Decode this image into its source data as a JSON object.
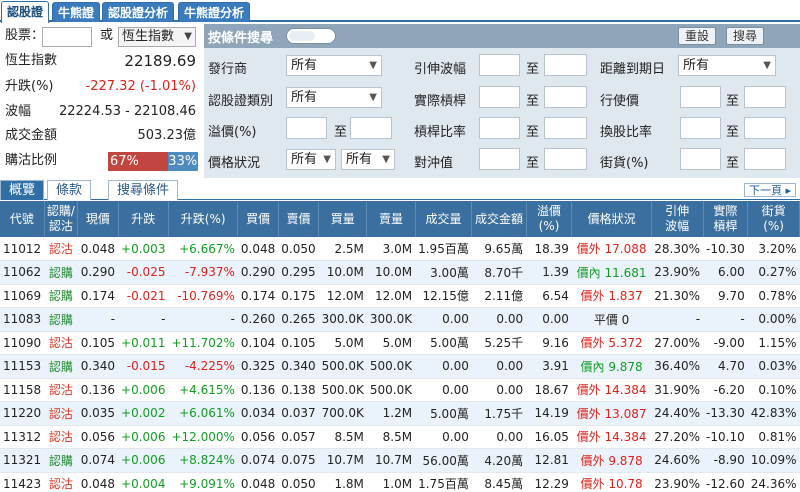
{
  "tabs": [
    "認股證",
    "牛熊證",
    "認股證分析",
    "牛熊證分析"
  ],
  "left": {
    "stock_label": "股票：",
    "or_label": "或",
    "index_select": "恆生指數",
    "index_label": "恆生指數",
    "index_value": "22189.69",
    "change_label": "升跌(%)",
    "change_value": "-227.32 (-1.01%)",
    "range_label": "波幅",
    "range_value": "22224.53 - 22108.46",
    "turnover_label": "成交金額",
    "turnover_value": "503.23億",
    "ratio_label": "購沽比例",
    "ratio_call": "67%",
    "ratio_put": "33%",
    "ratio_call_fraction": 0.67
  },
  "search": {
    "title": "按條件搜尋",
    "reset": "重設",
    "search": "搜尋",
    "to": "至",
    "issuer_label": "發行商",
    "issuer_value": "所有",
    "type_label": "認股證類別",
    "type_value": "所有",
    "premium_label": "溢價(%)",
    "price_status_label": "價格狀況",
    "price_status_value1": "所有",
    "price_status_value2": "所有",
    "iv_label": "引伸波幅",
    "eff_gear_label": "實際槓桿",
    "gear_label": "槓桿比率",
    "hedge_label": "對沖值",
    "expiry_label": "距離到期日",
    "expiry_value": "所有",
    "strike_label": "行使價",
    "conv_label": "換股比率",
    "outstanding_label": "街貨(%)"
  },
  "subtabs": [
    "概覽",
    "條款",
    "搜尋條件"
  ],
  "next_page": "下一頁",
  "table": {
    "headers": [
      "代號",
      "認購/\n認沽",
      "現價",
      "升跌",
      "升跌(%)",
      "買價",
      "賣價",
      "買量",
      "賣量",
      "成交量",
      "成交金額",
      "溢價(%)",
      "價格狀況",
      "引伸\n波幅",
      "實際\n槓桿",
      "街貨\n(%)"
    ],
    "rows": [
      {
        "code": "11012",
        "type": "認沽",
        "kind": "put",
        "price": "0.048",
        "chg": "+0.003",
        "pct": "+6.667%",
        "dir": "up",
        "bid": "0.048",
        "ask": "0.050",
        "bidq": "2.5M",
        "askq": "3.0M",
        "vol": "1.95百萬",
        "amt": "9.65萬",
        "prem": "18.39",
        "status": "價外 17.088",
        "skind": "out",
        "iv": "28.30%",
        "eg": "-10.30",
        "os": "3.20%"
      },
      {
        "code": "11062",
        "type": "認購",
        "kind": "call",
        "price": "0.290",
        "chg": "-0.025",
        "pct": "-7.937%",
        "dir": "dn",
        "bid": "0.290",
        "ask": "0.295",
        "bidq": "10.0M",
        "askq": "10.0M",
        "vol": "3.00萬",
        "amt": "8.70千",
        "prem": "1.39",
        "status": "價內 11.681",
        "skind": "in",
        "iv": "23.90%",
        "eg": "6.00",
        "os": "0.27%"
      },
      {
        "code": "11069",
        "type": "認購",
        "kind": "call",
        "price": "0.174",
        "chg": "-0.021",
        "pct": "-10.769%",
        "dir": "dn",
        "bid": "0.174",
        "ask": "0.175",
        "bidq": "12.0M",
        "askq": "12.0M",
        "vol": "12.15億",
        "amt": "2.11億",
        "prem": "6.54",
        "status": "價外 1.837",
        "skind": "out",
        "iv": "21.30%",
        "eg": "9.70",
        "os": "0.78%"
      },
      {
        "code": "11083",
        "type": "認購",
        "kind": "call",
        "price": "-",
        "chg": "-",
        "pct": "-",
        "dir": "",
        "bid": "0.260",
        "ask": "0.265",
        "bidq": "300.0K",
        "askq": "300.0K",
        "vol": "0.00",
        "amt": "0.00",
        "prem": "0.00",
        "status": "平價 0",
        "skind": "at",
        "iv": "-",
        "eg": "-",
        "os": "0.00%"
      },
      {
        "code": "11090",
        "type": "認沽",
        "kind": "put",
        "price": "0.105",
        "chg": "+0.011",
        "pct": "+11.702%",
        "dir": "up",
        "bid": "0.104",
        "ask": "0.105",
        "bidq": "5.0M",
        "askq": "5.0M",
        "vol": "5.00萬",
        "amt": "5.25千",
        "prem": "9.16",
        "status": "價外 5.372",
        "skind": "out",
        "iv": "27.00%",
        "eg": "-9.00",
        "os": "1.15%"
      },
      {
        "code": "11153",
        "type": "認購",
        "kind": "call",
        "price": "0.340",
        "chg": "-0.015",
        "pct": "-4.225%",
        "dir": "dn",
        "bid": "0.325",
        "ask": "0.340",
        "bidq": "500.0K",
        "askq": "500.0K",
        "vol": "0.00",
        "amt": "0.00",
        "prem": "3.91",
        "status": "價內 9.878",
        "skind": "in",
        "iv": "36.40%",
        "eg": "4.70",
        "os": "0.03%"
      },
      {
        "code": "11158",
        "type": "認沽",
        "kind": "put",
        "price": "0.136",
        "chg": "+0.006",
        "pct": "+4.615%",
        "dir": "up",
        "bid": "0.136",
        "ask": "0.138",
        "bidq": "500.0K",
        "askq": "500.0K",
        "vol": "0.00",
        "amt": "0.00",
        "prem": "18.67",
        "status": "價外 14.384",
        "skind": "out",
        "iv": "31.90%",
        "eg": "-6.20",
        "os": "0.10%"
      },
      {
        "code": "11220",
        "type": "認沽",
        "kind": "put",
        "price": "0.035",
        "chg": "+0.002",
        "pct": "+6.061%",
        "dir": "up",
        "bid": "0.034",
        "ask": "0.037",
        "bidq": "700.0K",
        "askq": "1.2M",
        "vol": "5.00萬",
        "amt": "1.75千",
        "prem": "14.19",
        "status": "價外 13.087",
        "skind": "out",
        "iv": "24.40%",
        "eg": "-13.30",
        "os": "42.83%"
      },
      {
        "code": "11312",
        "type": "認沽",
        "kind": "put",
        "price": "0.056",
        "chg": "+0.006",
        "pct": "+12.000%",
        "dir": "up",
        "bid": "0.056",
        "ask": "0.057",
        "bidq": "8.5M",
        "askq": "8.5M",
        "vol": "0.00",
        "amt": "0.00",
        "prem": "16.05",
        "status": "價外 14.384",
        "skind": "out",
        "iv": "27.20%",
        "eg": "-10.10",
        "os": "0.81%"
      },
      {
        "code": "11321",
        "type": "認購",
        "kind": "call",
        "price": "0.074",
        "chg": "+0.006",
        "pct": "+8.824%",
        "dir": "up",
        "bid": "0.074",
        "ask": "0.075",
        "bidq": "10.7M",
        "askq": "10.7M",
        "vol": "56.00萬",
        "amt": "4.20萬",
        "prem": "12.81",
        "status": "價外 9.878",
        "skind": "out",
        "iv": "24.60%",
        "eg": "-8.90",
        "os": "10.09%"
      },
      {
        "code": "11423",
        "type": "認沽",
        "kind": "put",
        "price": "0.048",
        "chg": "+0.004",
        "pct": "+9.091%",
        "dir": "up",
        "bid": "0.048",
        "ask": "0.050",
        "bidq": "1.8M",
        "askq": "1.0M",
        "vol": "1.75百萬",
        "amt": "8.45萬",
        "prem": "12.29",
        "status": "價外 10.78",
        "skind": "out",
        "iv": "23.90%",
        "eg": "-12.60",
        "os": "24.36%"
      }
    ]
  },
  "colors": {
    "accent": "#2f6fa6",
    "call": "#208a2f",
    "put": "#d83a2a",
    "status_out": "#e0201a",
    "status_in": "#119c22",
    "up": "#119c22",
    "down": "#e0201a"
  }
}
